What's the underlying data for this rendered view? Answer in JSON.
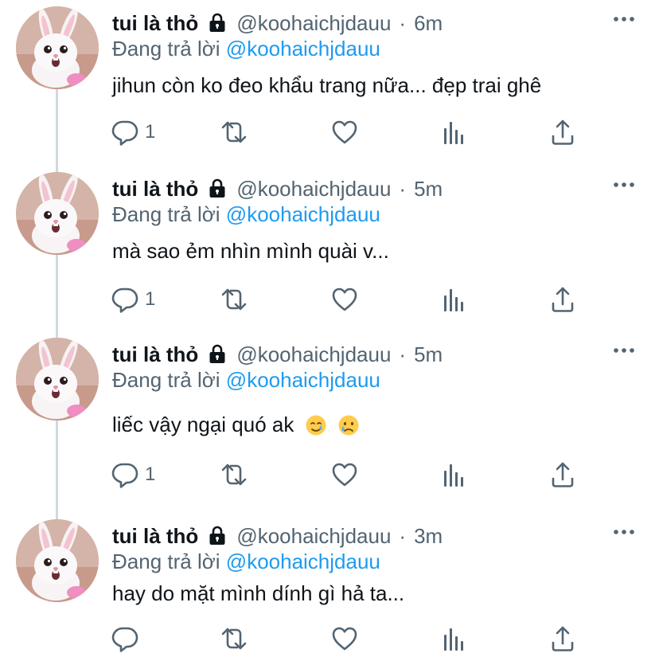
{
  "colors": {
    "text_primary": "#0f1419",
    "text_secondary": "#536471",
    "link": "#1d9bf0",
    "thread_line": "#cfd9de"
  },
  "icons": {
    "lock": "lock-icon",
    "more": "more-horizontal-icon",
    "reply": "reply-icon",
    "retweet": "retweet-icon",
    "like": "heart-icon",
    "analytics": "analytics-icon",
    "share": "share-icon"
  },
  "tweets": [
    {
      "display_name": "tui là thỏ",
      "handle": "@koohaichjdauu",
      "separator": "·",
      "time": "6m",
      "reply_prefix": "Đang trả lời",
      "reply_to": "@koohaichjdauu",
      "text": "jihun còn ko đeo khẩu trang nữa... đẹp trai ghê",
      "reply_count": "1"
    },
    {
      "display_name": "tui là thỏ",
      "handle": "@koohaichjdauu",
      "separator": "·",
      "time": "5m",
      "reply_prefix": "Đang trả lời",
      "reply_to": "@koohaichjdauu",
      "text": "mà sao ẻm nhìn mình quài v...",
      "reply_count": "1"
    },
    {
      "display_name": "tui là thỏ",
      "handle": "@koohaichjdauu",
      "separator": "·",
      "time": "5m",
      "reply_prefix": "Đang trả lời",
      "reply_to": "@koohaichjdauu",
      "text": "liếc vậy ngại quó ak",
      "emojis": [
        "smiling-face-with-tear",
        "crying-face"
      ],
      "reply_count": "1"
    },
    {
      "display_name": "tui là thỏ",
      "handle": "@koohaichjdauu",
      "separator": "·",
      "time": "3m",
      "reply_prefix": "Đang trả lời",
      "reply_to": "@koohaichjdauu",
      "text": "hay do mặt mình dính gì hả ta...",
      "reply_count": ""
    }
  ]
}
